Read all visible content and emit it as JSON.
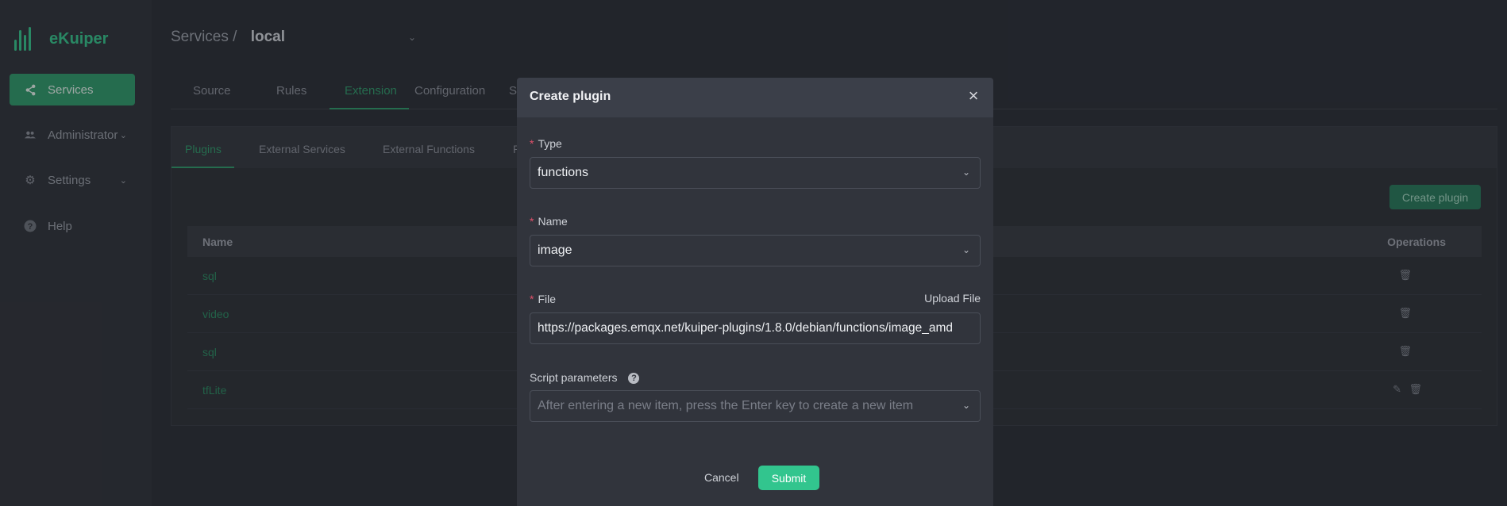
{
  "app": {
    "name": "eKuiper"
  },
  "sidebar": {
    "items": [
      {
        "label": "Services",
        "icon": "share-icon"
      },
      {
        "label": "Administrator",
        "icon": "users-icon"
      },
      {
        "label": "Settings",
        "icon": "gear-icon"
      },
      {
        "label": "Help",
        "icon": "help-circle-icon"
      }
    ]
  },
  "breadcrumb": {
    "root": "Services",
    "separator": "/",
    "current": "local"
  },
  "top_tabs": [
    "Source",
    "Rules",
    "Extension",
    "Configuration",
    "S"
  ],
  "sub_tabs": [
    "Plugins",
    "External Services",
    "External Functions",
    "P"
  ],
  "create_plugin_button": "Create plugin",
  "table": {
    "columns": [
      "Name",
      "Operations"
    ],
    "rows": [
      {
        "name": "sql"
      },
      {
        "name": "video"
      },
      {
        "name": "sql"
      },
      {
        "name": "tfLite"
      }
    ]
  },
  "modal": {
    "title": "Create plugin",
    "required_mark": "*",
    "type_label": "Type",
    "type_value": "functions",
    "name_label": "Name",
    "name_value": "image",
    "file_label": "File",
    "upload_label": "Upload File",
    "file_value": "https://packages.emqx.net/kuiper-plugins/1.8.0/debian/functions/image_amd",
    "script_label": "Script parameters",
    "script_placeholder": "After entering a new item, press the Enter key to create a new item",
    "cancel": "Cancel",
    "submit": "Submit"
  },
  "colors": {
    "accent": "#2f9a6b",
    "submit": "#32c58e",
    "required": "#e0506a"
  }
}
